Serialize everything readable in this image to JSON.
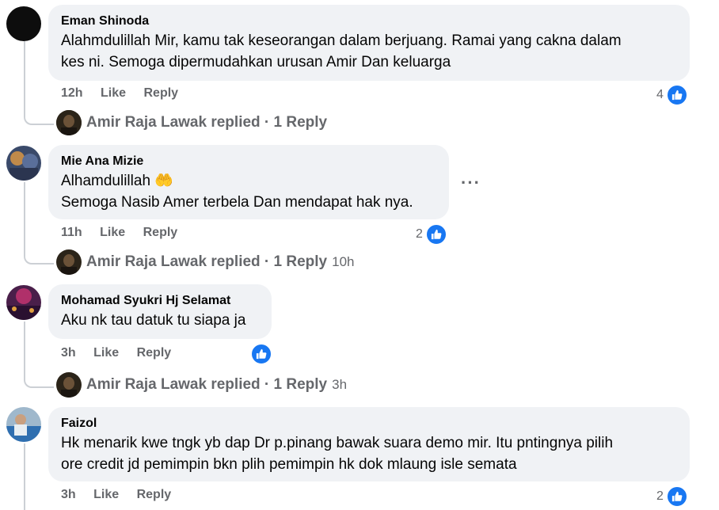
{
  "colors": {
    "accent": "#1877f2",
    "bubble": "#f0f2f5",
    "muted": "#65676b",
    "text": "#050505"
  },
  "comments": [
    {
      "author": "Eman Shinoda",
      "lines": [
        "Alahmdulillah Mir, kamu tak keseorangan dalam berjuang. Ramai yang cakna dalam",
        "kes ni. Semoga dipermudahkan urusan Amir Dan keluarga"
      ],
      "time": "12h",
      "like_label": "Like",
      "reply_label": "Reply",
      "reaction_count": "4",
      "reply_summary": {
        "text": "Amir Raja Lawak replied · 1 Reply",
        "time": ""
      }
    },
    {
      "author": "Mie Ana Mizie",
      "lines": [
        "Alhamdulillah 🤲",
        "Semoga Nasib Amer terbela Dan mendapat hak nya."
      ],
      "time": "11h",
      "like_label": "Like",
      "reply_label": "Reply",
      "reaction_count": "2",
      "more": "···",
      "reply_summary": {
        "text": "Amir Raja Lawak replied · 1 Reply",
        "time": "10h"
      }
    },
    {
      "author": "Mohamad Syukri Hj Selamat",
      "lines": [
        "Aku nk tau datuk tu siapa ja"
      ],
      "time": "3h",
      "like_label": "Like",
      "reply_label": "Reply",
      "reaction_count": "",
      "reply_summary": {
        "text": "Amir Raja Lawak replied · 1 Reply",
        "time": "3h"
      }
    },
    {
      "author": "Faizol",
      "lines": [
        "Hk menarik kwe tngk yb dap Dr p.pinang bawak suara demo mir. Itu pntingnya pilih",
        "ore credit jd pemimpin bkn plih pemimpin hk dok mlaung isle semata"
      ],
      "time": "3h",
      "like_label": "Like",
      "reply_label": "Reply",
      "reaction_count": "2"
    }
  ]
}
